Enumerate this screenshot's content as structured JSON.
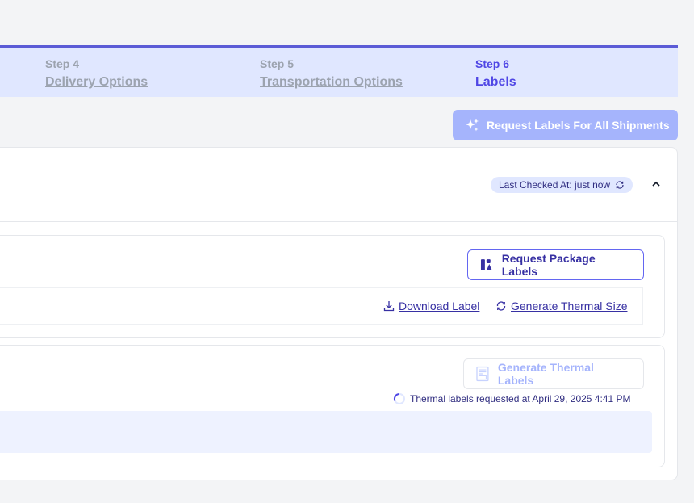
{
  "stepper": {
    "steps": [
      {
        "num": "Step 4",
        "name": "Delivery Options",
        "active": false
      },
      {
        "num": "Step 5",
        "name": "Transportation Options",
        "active": false
      },
      {
        "num": "Step 6",
        "name": "Labels",
        "active": true
      }
    ]
  },
  "actions": {
    "request_all_label": "Request Labels For All Shipments"
  },
  "shipment": {
    "last_checked": "Last Checked At: just now",
    "package_labels": {
      "request_button": "Request Package Labels",
      "download_link": "Download Label",
      "thermal_link": "Generate Thermal Size"
    },
    "thermal": {
      "button": "Generate Thermal Labels",
      "status": "Thermal labels requested at April 29, 2025 4:41 PM"
    }
  },
  "colors": {
    "accent": "#4f46e5",
    "accent_light": "#e0e7ff",
    "button_primary_disabled": "#a5b4fc",
    "muted": "#9ca3af"
  },
  "icons": {
    "request_all": "sparkles-icon",
    "refresh": "refresh-icon",
    "collapse": "chevron-up-icon",
    "package_label": "label-icon",
    "download": "download-icon",
    "thermal": "thermal-printer-icon",
    "spinner": "spinner-icon"
  }
}
